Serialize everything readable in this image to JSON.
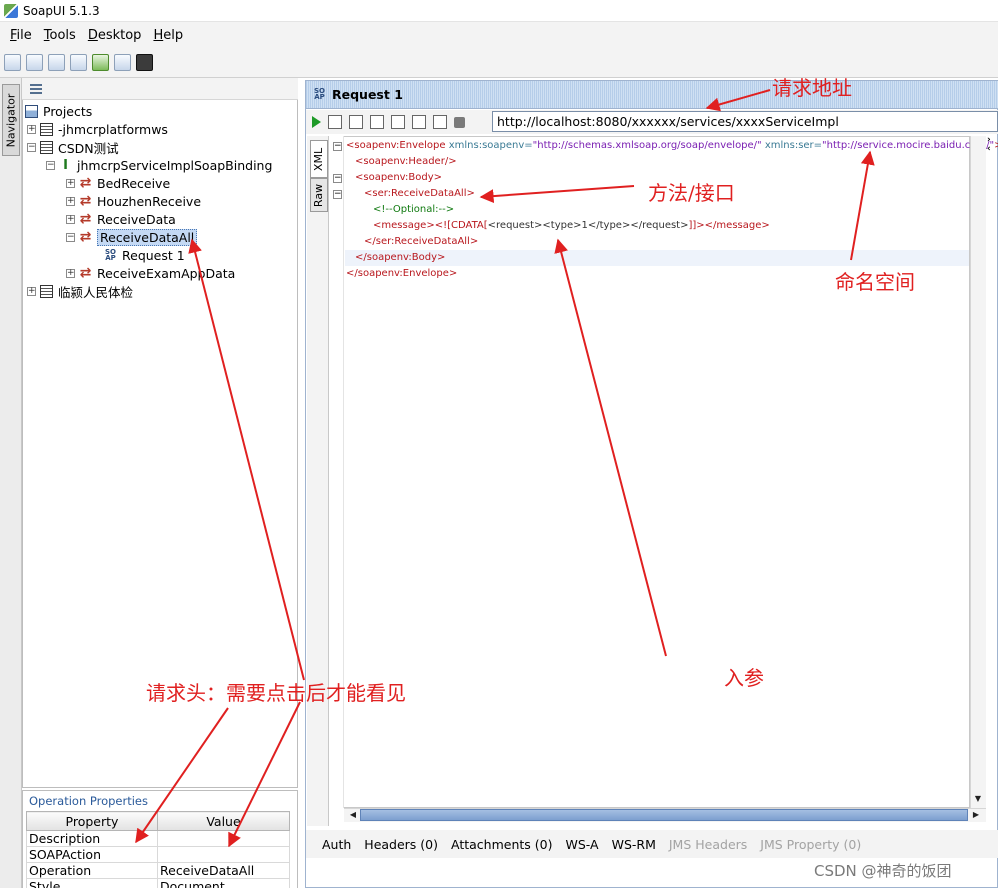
{
  "window": {
    "title": "SoapUI 5.1.3"
  },
  "menu": [
    {
      "label": "File",
      "mnemonic": "F",
      "rest": "ile"
    },
    {
      "label": "Tools",
      "mnemonic": "T",
      "rest": "ools"
    },
    {
      "label": "Desktop",
      "mnemonic": "D",
      "rest": "esktop"
    },
    {
      "label": "Help",
      "mnemonic": "H",
      "rest": "elp"
    }
  ],
  "navigator": {
    "tab_label": "Navigator"
  },
  "tree": {
    "root": "Projects",
    "items": [
      {
        "label": "-jhmcrplatformws",
        "icon": "wsdl-project-icon"
      },
      {
        "label": "CSDN测试",
        "icon": "wsdl-project-icon"
      },
      {
        "label": "jhmcrpServiceImplSoapBinding",
        "icon": "binding-icon"
      },
      {
        "label": "BedReceive",
        "icon": "operation-icon"
      },
      {
        "label": "HouzhenReceive",
        "icon": "operation-icon"
      },
      {
        "label": "ReceiveData",
        "icon": "operation-icon"
      },
      {
        "label": "ReceiveDataAll",
        "icon": "operation-icon",
        "selected": true
      },
      {
        "label": "Request 1",
        "icon": "soap-request-icon"
      },
      {
        "label": "ReceiveExamAppData",
        "icon": "operation-icon"
      },
      {
        "label": "临颍人民体检",
        "icon": "wsdl-project-icon"
      }
    ]
  },
  "op_properties": {
    "title": "Operation Properties",
    "headers": [
      "Property",
      "Value"
    ],
    "rows": [
      [
        "Description",
        ""
      ],
      [
        "SOAPAction",
        ""
      ],
      [
        "Operation",
        "ReceiveDataAll"
      ],
      [
        "Style",
        "Document"
      ]
    ]
  },
  "request": {
    "icon_text": "SO AP",
    "title": "Request 1",
    "url": "http://localhost:8080/xxxxxx/services/xxxxServiceImpl",
    "side_tabs": [
      "XML",
      "Raw"
    ],
    "xml_lines": [
      {
        "parts": [
          [
            "tg",
            "<soapenv:Envelope"
          ],
          [
            "at",
            " xmlns:soapenv="
          ],
          [
            "vl",
            "\"http://schemas.xmlsoap.org/soap/envelope/\""
          ],
          [
            "at",
            " xmlns:ser="
          ],
          [
            "vl",
            "\"http://service.mocire.baidu.com/\""
          ],
          [
            "tg",
            ">"
          ]
        ]
      },
      {
        "parts": [
          [
            "tg",
            "<soapenv:Header/>"
          ]
        ]
      },
      {
        "parts": [
          [
            "tg",
            "<soapenv:Body>"
          ]
        ]
      },
      {
        "parts": [
          [
            "tg",
            "<ser:ReceiveDataAll>"
          ]
        ]
      },
      {
        "parts": [
          [
            "cm",
            "<!--Optional:-->"
          ]
        ]
      },
      {
        "parts": [
          [
            "tg",
            "<message>"
          ],
          [
            "tg",
            "<![CDATA["
          ],
          [
            "tx",
            "<request><type>1</type></request>"
          ],
          [
            "tg",
            "]]>"
          ],
          [
            "tg",
            "</message>"
          ]
        ]
      },
      {
        "parts": [
          [
            "tg",
            "</ser:ReceiveDataAll>"
          ]
        ]
      },
      {
        "parts": [
          [
            "tg",
            "</soapenv:Body>"
          ]
        ]
      },
      {
        "parts": [
          [
            "tg",
            "</soapenv:Envelope>"
          ]
        ]
      }
    ],
    "bottom_tabs": [
      {
        "label": "Auth",
        "enabled": true
      },
      {
        "label": "Headers (0)",
        "enabled": true
      },
      {
        "label": "Attachments (0)",
        "enabled": true
      },
      {
        "label": "WS-A",
        "enabled": true
      },
      {
        "label": "WS-RM",
        "enabled": true
      },
      {
        "label": "JMS Headers",
        "enabled": false
      },
      {
        "label": "JMS Property (0)",
        "enabled": false
      }
    ]
  },
  "annotations": {
    "url": "请求地址",
    "method": "方法/接口",
    "namespace": "命名空间",
    "params": "入参",
    "headers": "请求头：需要点击后才能看见"
  },
  "watermark": "CSDN @神奇的饭团",
  "colors": {
    "annotation": "#e02020",
    "xml_tag": "#b8171d",
    "xml_attr": "#3a7a94",
    "xml_value": "#7a1fb2",
    "xml_comment": "#117a11"
  }
}
